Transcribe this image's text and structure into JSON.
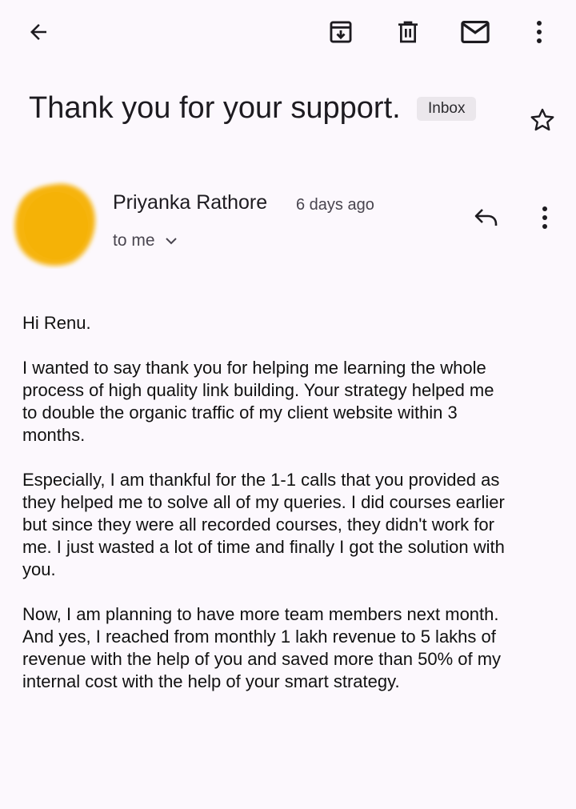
{
  "toolbar": {
    "back_icon": "arrow-left-icon",
    "archive_icon": "archive-icon",
    "delete_icon": "trash-icon",
    "mark_unread_icon": "mail-icon",
    "more_icon": "more-vert-icon"
  },
  "email": {
    "subject": "Thank you for your support.",
    "label_badge": "Inbox",
    "star_icon": "star-outline-icon"
  },
  "message": {
    "sender_name": "Priyanka Rathore",
    "time_ago": "6 days ago",
    "recipient": "to me",
    "avatar_color": "#f6b40e",
    "reply_icon": "reply-icon",
    "more_icon": "more-vert-icon",
    "body": {
      "greeting": "Hi Renu.",
      "p1": [
        "I wanted to say thank you for helping me learning the whole",
        "process of high quality link building. Your strategy helped me",
        "to double the organic traffic of my client website within 3",
        "months."
      ],
      "p2": [
        "Especially, I am thankful for the 1-1 calls that you provided as",
        "they helped me to solve all of my queries. I did courses earlier",
        "but since they were all recorded courses, they didn't work for",
        "me. I just wasted a lot of time and finally I got the solution with",
        "you."
      ],
      "p3": [
        "Now, I am planning to have more team members next month.",
        "And yes, I reached from monthly 1 lakh revenue to 5 lakhs of",
        "revenue with the help of you and saved more than 50% of my",
        "internal cost with the help of your smart strategy."
      ]
    }
  }
}
